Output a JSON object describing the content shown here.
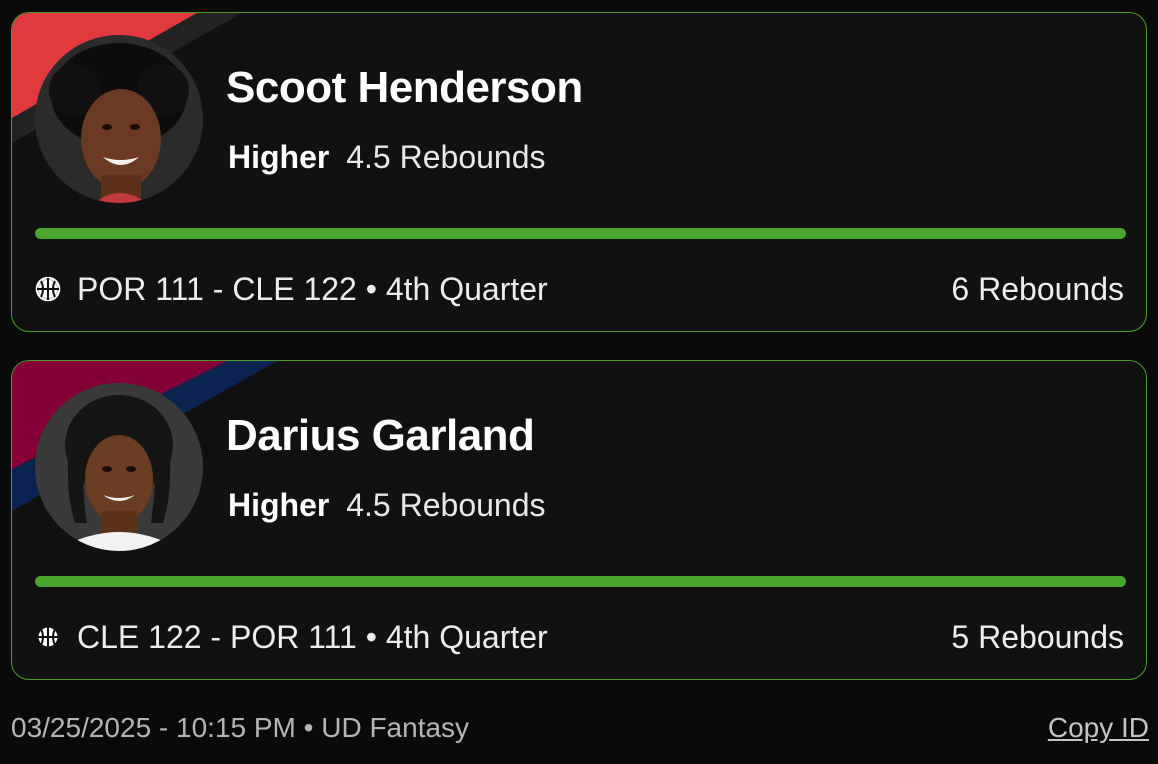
{
  "picks": [
    {
      "player_name": "Scoot Henderson",
      "direction": "Higher",
      "line": "4.5 Rebounds",
      "game": "POR 111 - CLE 122 • 4th Quarter",
      "result": "6 Rebounds",
      "progress_fraction": 1.0,
      "team_colors": [
        "#e03a3e",
        "#1e1e1e"
      ],
      "icon": "basketball-icon"
    },
    {
      "player_name": "Darius Garland",
      "direction": "Higher",
      "line": "4.5 Rebounds",
      "game": "CLE 122 - POR 111 • 4th Quarter",
      "result": "5 Rebounds",
      "progress_fraction": 1.0,
      "team_colors": [
        "#860038",
        "#041e42"
      ],
      "icon": "basketball-icon"
    }
  ],
  "footer": {
    "timestamp": "03/25/2025 - 10:15 PM • UD Fantasy",
    "copy_label": "Copy ID"
  },
  "colors": {
    "accent_green": "#4aa52e",
    "card_border": "#4a9a2e",
    "background": "#0a0a0a",
    "card_background": "#111111"
  }
}
